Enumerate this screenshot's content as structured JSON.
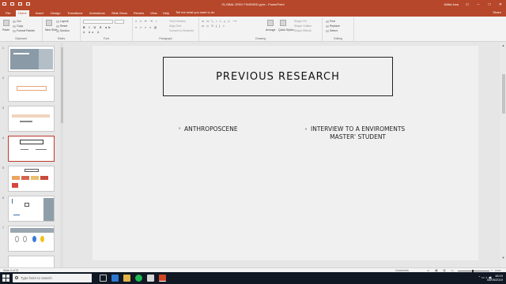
{
  "window": {
    "title": "GLOBAL DRID FINISHED.pptx - PowerPoint",
    "user": "Aliitta Irwa"
  },
  "ribbon_tabs": [
    "File",
    "Home",
    "Insert",
    "Design",
    "Transitions",
    "Animations",
    "Slide Show",
    "Review",
    "View",
    "Help"
  ],
  "active_tab": "Home",
  "tell_me": "Tell me what you want to do",
  "share": "Share",
  "ribbon": {
    "clipboard": {
      "paste": "Paste",
      "cut": "Cut",
      "copy": "Copy",
      "format_painter": "Format Painter",
      "label": "Clipboard"
    },
    "slides": {
      "new_slide": "New Slide",
      "layout": "Layout",
      "reset": "Reset",
      "section": "Section",
      "label": "Slides"
    },
    "font": {
      "label": "Font"
    },
    "paragraph": {
      "text_direction": "Text Direction",
      "align_text": "Align Text",
      "convert_smartart": "Convert to SmartArt",
      "label": "Paragraph"
    },
    "drawing": {
      "arrange": "Arrange",
      "quick_styles": "Quick Styles",
      "shape_fill": "Shape Fill",
      "shape_outline": "Shape Outline",
      "shape_effects": "Shape Effects",
      "label": "Drawing"
    },
    "editing": {
      "find": "Find",
      "replace": "Replace",
      "select": "Select",
      "label": "Editing"
    }
  },
  "thumbnails": [
    {
      "num": "1"
    },
    {
      "num": "2"
    },
    {
      "num": "3"
    },
    {
      "num": "4"
    },
    {
      "num": "5"
    },
    {
      "num": "6"
    },
    {
      "num": "7"
    }
  ],
  "active_slide": 4,
  "slide": {
    "title": "PREVIOUS RESEARCH",
    "bullet_left": "ANTHROPOSCENE",
    "bullet_right_line1": "INTERVIEW TO A ENVIROMENTS",
    "bullet_right_line2": "MASTER' STUDENT"
  },
  "status": {
    "slide_counter": "Slide 4 of 21",
    "comments": "Comments",
    "zoom": "103%"
  },
  "taskbar": {
    "search_placeholder": "Type here to search",
    "time": "18:19",
    "date": "08/05/2019"
  },
  "colors": {
    "accent": "#b7472a",
    "taskbar": "#101824",
    "slide_bg": "#f0f0f0"
  }
}
